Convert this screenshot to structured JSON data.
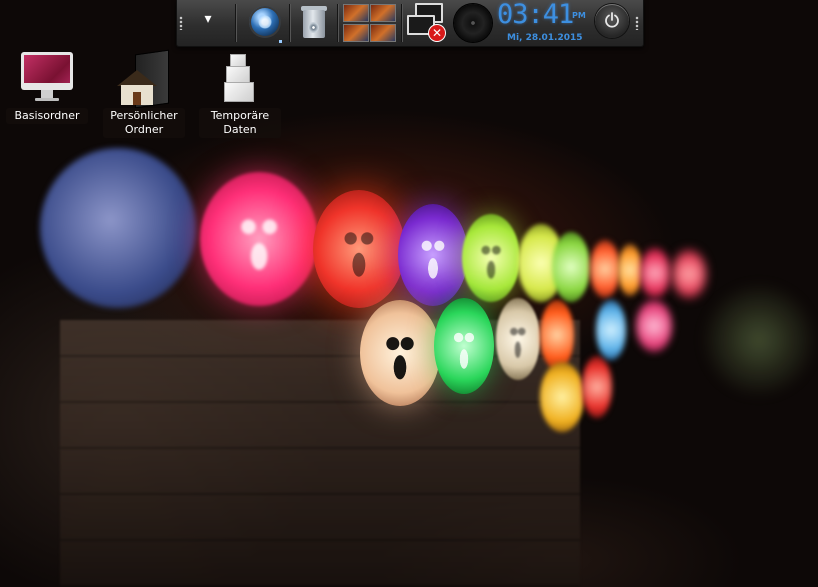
{
  "panel": {
    "menu_icon": "chevron-down-icon",
    "launcher_icon": "kde-launcher-icon",
    "trash_icon": "trash-icon",
    "pager_icon": "virtual-desktop-pager",
    "network_icon": "network-disconnected-icon",
    "speaker_icon": "speaker-icon",
    "power_icon": "power-icon",
    "clock": {
      "time": "03:41",
      "ampm": "PM",
      "date": "Mi, 28.01.2015"
    }
  },
  "desktop": {
    "icons": [
      {
        "label": "Basisordner",
        "icon": "computer-icon"
      },
      {
        "label": "Persönlicher\nOrdner",
        "icon": "home-folder-icon"
      },
      {
        "label": "Temporäre\nDaten",
        "icon": "boxes-icon"
      }
    ]
  },
  "colors": {
    "clock_accent": "#3d8fe0",
    "panel_bg": "#2e2e2e",
    "network_error": "#d81a1a"
  }
}
